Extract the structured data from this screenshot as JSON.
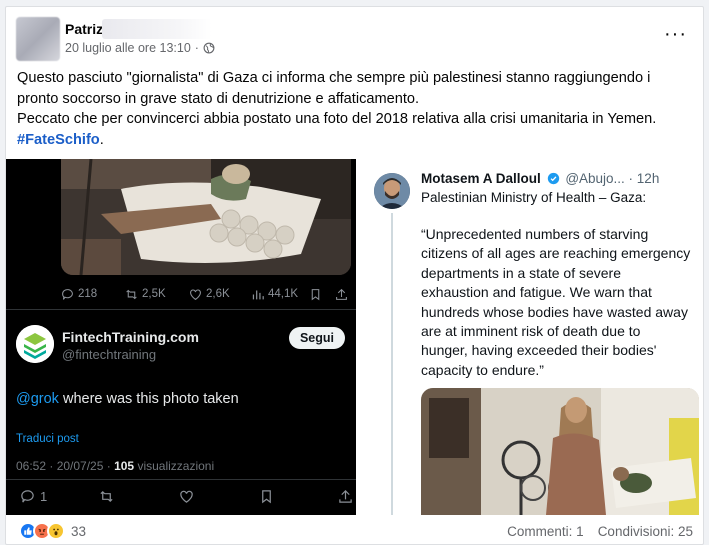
{
  "post": {
    "author": "Patriz",
    "timestamp": "20 luglio alle ore 13:10",
    "separator": "·",
    "more_label": "···",
    "caption_lines": [
      "Questo pasciuto \"giornalista\" di Gaza ci informa che sempre più palestinesi stanno raggiungendo i",
      "pronto soccorso in grave stato di denutrizione e affaticamento.",
      "Peccato che per convincerci abbia postato una foto del 2018 relativa alla crisi umanitaria in Yemen."
    ],
    "hashtag": "#FateSchifo",
    "hashtag_suffix": "."
  },
  "left_tweet": {
    "stats": {
      "replies": "218",
      "retweets": "2,5K",
      "likes": "2,6K",
      "views": "44,1K"
    },
    "account_name": "FintechTraining.com",
    "account_handle": "@fintechtraining",
    "follow_label": "Segui",
    "mention": "@grok",
    "text": " where was this photo taken",
    "translate_label": "Traduci post",
    "time_date": "06:52 · 20/07/25 · ",
    "views_count": "105",
    "views_label": " visualizzazioni",
    "reply_count": "1"
  },
  "right_tweet": {
    "name": "Motasem A Dalloul",
    "handle": "@Abujo...",
    "dot": " · ",
    "age": "12h",
    "ministry": "Palestinian Ministry of Health – Gaza:",
    "quote": "“Unprecedented numbers of starving citizens of all ages are reaching emergency departments in a state of severe exhaustion and fatigue. We warn that hundreds whose bodies have wasted away are at imminent risk of death due to hunger, having exceeded their bodies' capacity to endure.”"
  },
  "footer": {
    "reactions_count": "33",
    "comments": "Commenti: 1",
    "shares": "Condivisioni: 25"
  },
  "colors": {
    "hashtag": "#1b5ec8",
    "twitter_blue": "#1d9bf0",
    "like_blue": "#1877f2",
    "angry_orange": "#f7714c",
    "wow_yellow": "#f7c531"
  }
}
